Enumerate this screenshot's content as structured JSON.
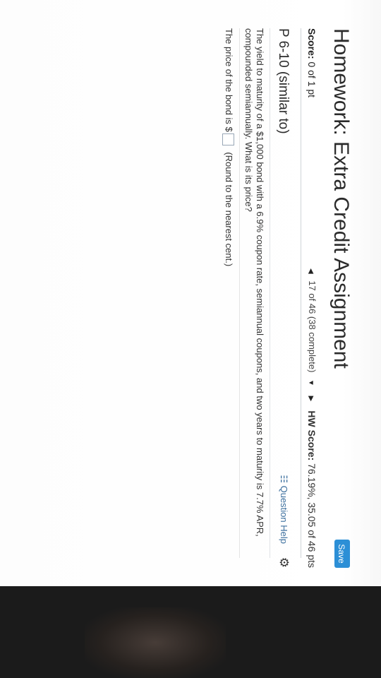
{
  "header": {
    "title": "Homework: Extra Credit Assignment",
    "save_label": "Save",
    "score_label": "Score:",
    "score_value": "0 of 1 pt",
    "hw_score_label": "HW Score:",
    "hw_score_value": "76.19%, 35.05 of 46 pts"
  },
  "navigation": {
    "progress": "17 of 46 (38 complete)",
    "prev_icon": "triangle-left-icon",
    "next_icon": "triangle-right-icon",
    "dropdown_icon": "triangle-down-icon"
  },
  "problem": {
    "title": "P 6-10 (similar to)",
    "help_label": "Question Help",
    "help_icon": "list-icon",
    "settings_icon": "gear-icon",
    "question_text": "The yield to maturity of a $1,000 bond with a 6.9% coupon rate, semiannual coupons, and two years to maturity is 7.7% APR, compounded semiannually. What is its price?",
    "answer_prefix": "The price of the bond is $",
    "answer_value": "",
    "answer_hint": "(Round to the nearest cent.)"
  },
  "colors": {
    "save_button": "#2c8fd6",
    "help_link": "#3c6f9e"
  }
}
